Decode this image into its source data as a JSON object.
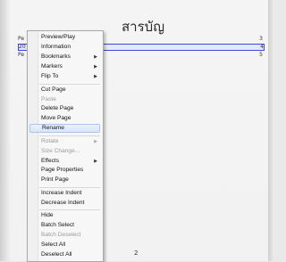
{
  "toc": {
    "title": "สารบัญ",
    "rows": [
      {
        "label": "Pe",
        "page": "3"
      },
      {
        "label": "20",
        "page": "4"
      },
      {
        "label": "Pe",
        "page": "5"
      }
    ],
    "footer_page": "2"
  },
  "menu": {
    "items": [
      {
        "label": "Preview/Play",
        "state": "normal"
      },
      {
        "label": "Information",
        "state": "normal"
      },
      {
        "label": "Bookmarks",
        "state": "normal",
        "submenu": "▶"
      },
      {
        "label": "Markers",
        "state": "normal",
        "submenu": "▶"
      },
      {
        "label": "Flip To",
        "state": "normal",
        "submenu": "▶"
      },
      {
        "label": "Cut Page",
        "state": "normal"
      },
      {
        "label": "Paste",
        "state": "disabled"
      },
      {
        "label": "Delete Page",
        "state": "normal"
      },
      {
        "label": "Move Page",
        "state": "normal"
      },
      {
        "label": "Rename",
        "state": "highlighted"
      },
      {
        "label": "Rotate",
        "state": "disabled",
        "submenu": "▶"
      },
      {
        "label": "Size Change...",
        "state": "disabled"
      },
      {
        "label": "Effects",
        "state": "normal",
        "submenu": "▶"
      },
      {
        "label": "Page Properties",
        "state": "normal"
      },
      {
        "label": "Print Page",
        "state": "normal"
      },
      {
        "label": "Increase Indent",
        "state": "normal"
      },
      {
        "label": "Decrease Indent",
        "state": "normal"
      },
      {
        "label": "Hide",
        "state": "normal"
      },
      {
        "label": "Batch Select",
        "state": "normal"
      },
      {
        "label": "Batch Deselect",
        "state": "disabled"
      },
      {
        "label": "Select All",
        "state": "normal"
      },
      {
        "label": "Deselect All",
        "state": "normal"
      }
    ]
  },
  "colors": {
    "selection_border": "#3a49d6",
    "highlight_border": "#a9c6ea",
    "disabled_text": "#9a9a9a"
  }
}
